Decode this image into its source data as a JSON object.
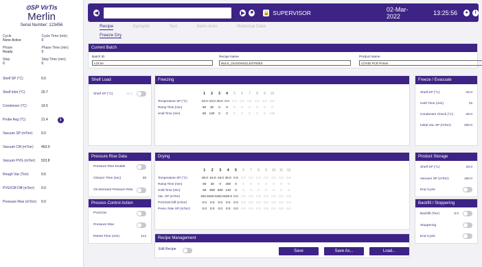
{
  "left": {
    "logo": "⊙SP VirTis",
    "title": "Merlin",
    "serial": "Serial Number: 123456",
    "status": [
      {
        "k1": "Cycle",
        "v1": "None Active",
        "k2": "Cycle Time (min)",
        "v2": "0"
      },
      {
        "k1": "Phase",
        "v1": "Ready",
        "k2": "Phase Time (min)",
        "v2": "0"
      },
      {
        "k1": "Step",
        "v1": "0",
        "k2": "Step Time (min)",
        "v2": "0"
      }
    ],
    "readings": [
      {
        "k": "Shelf SP (°C)",
        "v": "0.0"
      },
      {
        "k": "Shelf Inlet (°C)",
        "v": "20.7"
      },
      {
        "k": "Condenser (°C)",
        "v": "19.5"
      },
      {
        "k": "Probe Avg (°C)",
        "v": "21.4"
      },
      {
        "k": "Vacuum SP (mTorr)",
        "v": "0.0"
      },
      {
        "k": "Vacuum CM (mTorr)",
        "v": "463.0"
      },
      {
        "k": "Vacuum PVG (mTorr)",
        "v": "523.8"
      },
      {
        "k": "Rough Vac (Torr)",
        "v": "0.6"
      },
      {
        "k": "PVG/CM Diff (mTorr)",
        "v": "0.0"
      },
      {
        "k": "Pressure Rise (mTorr)",
        "v": "0.0"
      }
    ]
  },
  "top": {
    "user": "SUPERVISOR",
    "date": "02-Mar-2022",
    "time": "13:25:56"
  },
  "tabs": [
    "Recipe",
    "Synoptic",
    "Test",
    "Semi-Auto",
    "Historical Data"
  ],
  "subtab": "Freeze Dry",
  "batch": {
    "title": "Current Batch",
    "id_label": "Batch ID",
    "id": "LOt 6A",
    "recipe_label": "Recipe Name",
    "recipe": "BULK_OLIGONUCLEOTIDES",
    "product_label": "Product Name",
    "product": "COVID PCR Primer"
  },
  "shelfload": {
    "title": "Shelf Load",
    "label": "Shelf SP (°C)",
    "value": "11.2"
  },
  "freezing": {
    "title": "Freezing",
    "steps": [
      "1",
      "2",
      "3",
      "4",
      "5",
      "6",
      "7",
      "8",
      "9",
      "10"
    ],
    "rows": [
      {
        "k": "Temperature SP (°C)",
        "v": [
          "-10.0",
          "-10.0",
          "-40.0",
          "0.0",
          "0.0",
          "0.0",
          "0.0",
          "0.0",
          "0.0",
          "0.0"
        ]
      },
      {
        "k": "Ramp Time (min)",
        "v": [
          "60",
          "30",
          "0",
          "0",
          "0",
          "0",
          "0",
          "0",
          "0",
          "0"
        ]
      },
      {
        "k": "Hold Time (min)",
        "v": [
          "60",
          "120",
          "0",
          "0",
          "0",
          "0",
          "0",
          "0",
          "0",
          "120"
        ]
      }
    ]
  },
  "freeze_evac": {
    "title": "Freeze / Evacuate",
    "rows": [
      {
        "k": "Shelf SP (°C)",
        "v": "-40.0"
      },
      {
        "k": "Hold Time (min)",
        "v": "15"
      },
      {
        "k": "Condenser Check (°C)",
        "v": "-45.0"
      },
      {
        "k": "Initial Vac SP (mTorr)",
        "v": "200.0"
      }
    ]
  },
  "pressure": {
    "title": "Pressure Rise Data",
    "enable": "Pressure Rise Enable",
    "closure": "Closure Time (sec)",
    "closure_v": "35",
    "ondemand": "On-Demand Pressure Rise"
  },
  "pca": {
    "title": "Process Control Action",
    "pvg": "PVG/CM",
    "prise": "Pressure Rise",
    "retest": "Retest Time (min)",
    "retest_v": "112"
  },
  "drying": {
    "title": "Drying",
    "steps": [
      "1",
      "2",
      "3",
      "4",
      "5",
      "6",
      "7",
      "8",
      "9",
      "10",
      "11",
      "12"
    ],
    "rows": [
      {
        "k": "Temperature SP (°C)",
        "v": [
          "-30.0",
          "-15.0",
          "-15.0",
          "30.0",
          "0.0",
          "0.0",
          "0.0",
          "0.0",
          "0.0",
          "0.0",
          "0.0",
          "0.0"
        ]
      },
      {
        "k": "Ramp Time (min)",
        "v": [
          "60",
          "30",
          "0",
          "400",
          "0",
          "0",
          "0",
          "0",
          "0",
          "0",
          "0",
          "0"
        ]
      },
      {
        "k": "Hold Time (min)",
        "v": [
          "60",
          "800",
          "800",
          "120",
          "0",
          "0",
          "0",
          "0",
          "0",
          "0",
          "0",
          "0"
        ]
      },
      {
        "k": "Vac. SP (mTorr)",
        "v": [
          "150.0",
          "150.0",
          "150.0",
          "150.0",
          "0.0",
          "0.0",
          "0.0",
          "0.0",
          "0.0",
          "0.0",
          "0.0",
          "0.0"
        ]
      },
      {
        "k": "PVG/CM Diff (mTorr)",
        "v": [
          "0.0",
          "0.0",
          "0.0",
          "0.0",
          "0.0",
          "0.0",
          "0.0",
          "0.0",
          "0.0",
          "0.0",
          "0.0",
          "0.0"
        ]
      },
      {
        "k": "Press. Rise SP (mTorr)",
        "v": [
          "0.0",
          "0.0",
          "0.0",
          "0.0",
          "0.0",
          "0.0",
          "0.0",
          "0.0",
          "0.0",
          "0.0",
          "0.0",
          "0.0"
        ]
      }
    ]
  },
  "storage": {
    "title": "Product Storage",
    "shelf": "Shelf SP (°C)",
    "shelf_v": "20.0",
    "vac": "Vacuum SP (mTorr)",
    "vac_v": "150.0",
    "end": "End Cycle"
  },
  "backfill": {
    "title": "Backfill / Stoppering",
    "bf": "Backfill (Torr)",
    "bf_v": "5.0",
    "stop": "Stoppering",
    "end": "End Cycle"
  },
  "recipe_mgmt": {
    "title": "Recipe Management",
    "edit": "Edit Recipe",
    "save": "Save",
    "saveas": "Save As...",
    "load": "Load..."
  }
}
